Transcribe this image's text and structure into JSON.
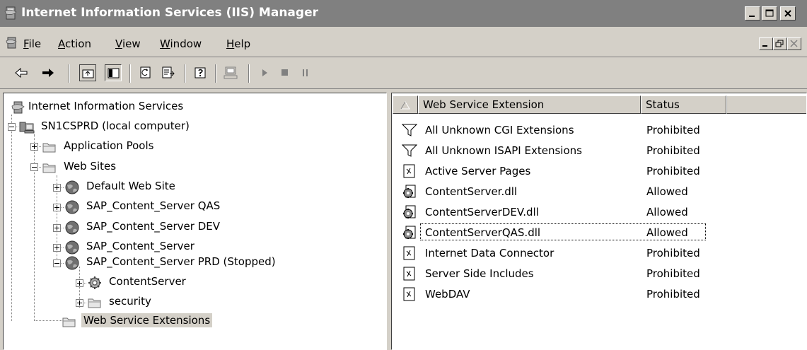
{
  "window": {
    "title": "Internet Information Services (IIS) Manager",
    "controls": [
      "minimize",
      "maximize",
      "close"
    ]
  },
  "menubar": {
    "items": [
      {
        "label": "File",
        "accel": "F"
      },
      {
        "label": "Action",
        "accel": "A"
      },
      {
        "label": "View",
        "accel": "V"
      },
      {
        "label": "Window",
        "accel": "W"
      },
      {
        "label": "Help",
        "accel": "H"
      }
    ]
  },
  "toolbar": {
    "buttons": [
      "back-arrow",
      "forward-arrow",
      "up-one-level",
      "show-hide-console-tree",
      "refresh",
      "export-list",
      "help",
      "connect",
      "start",
      "stop",
      "pause"
    ]
  },
  "tree": {
    "root": "Internet Information Services",
    "computer": "SN1CSPRD (local computer)",
    "app_pools": "Application Pools",
    "web_sites": "Web Sites",
    "sites": [
      "Default Web Site",
      "SAP_Content_Server QAS",
      "SAP_Content_Server DEV",
      "SAP_Content_Server",
      "SAP_Content_Server PRD (Stopped)"
    ],
    "children": [
      "ContentServer",
      "security"
    ],
    "wse": "Web Service Extensions"
  },
  "list": {
    "columns": [
      "Web Service Extension",
      "Status"
    ],
    "rows": [
      {
        "name": "All Unknown CGI Extensions",
        "status": "Prohibited",
        "icon": "filter-icon"
      },
      {
        "name": "All Unknown ISAPI Extensions",
        "status": "Prohibited",
        "icon": "filter-icon"
      },
      {
        "name": "Active Server Pages",
        "status": "Prohibited",
        "icon": "document-icon"
      },
      {
        "name": "ContentServer.dll",
        "status": "Allowed",
        "icon": "gear-document-icon"
      },
      {
        "name": "ContentServerDEV.dll",
        "status": "Allowed",
        "icon": "gear-document-icon"
      },
      {
        "name": "ContentServerQAS.dll",
        "status": "Allowed",
        "icon": "gear-document-icon"
      },
      {
        "name": "Internet Data Connector",
        "status": "Prohibited",
        "icon": "document-icon"
      },
      {
        "name": "Server Side Includes",
        "status": "Prohibited",
        "icon": "document-icon"
      },
      {
        "name": "WebDAV",
        "status": "Prohibited",
        "icon": "document-icon"
      }
    ],
    "focused_row": "ContentServerQAS.dll"
  },
  "colors": {
    "titlebar_inactive": "#808080",
    "face": "#d4d0c8",
    "pane_bg": "#ffffff"
  }
}
